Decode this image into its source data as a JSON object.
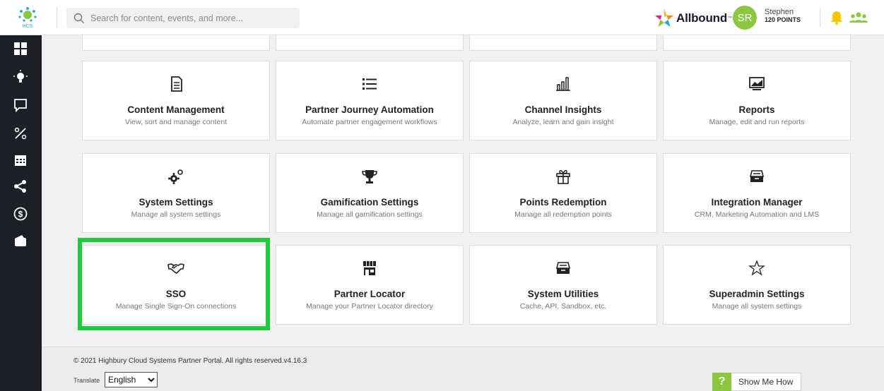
{
  "header": {
    "logo_text": "HCS",
    "search_placeholder": "Search for content, events, and more...",
    "brand_name": "Allbound",
    "brand_tm": "™",
    "avatar_initials": "SR",
    "user_name": "Stephen",
    "user_points": "120 POINTS"
  },
  "sidebar": {
    "items": [
      {
        "icon": "dashboard-grid-icon"
      },
      {
        "icon": "lightbulb-icon"
      },
      {
        "icon": "chat-icon"
      },
      {
        "icon": "percent-tools-icon"
      },
      {
        "icon": "calendar-icon"
      },
      {
        "icon": "share-icon"
      },
      {
        "icon": "dollar-icon"
      },
      {
        "icon": "wallet-icon"
      }
    ]
  },
  "cards": [
    {
      "title": "Content Management",
      "desc": "View, sort and manage content",
      "icon": "document-icon"
    },
    {
      "title": "Partner Journey Automation",
      "desc": "Automate partner engagement workflows",
      "icon": "list-icon"
    },
    {
      "title": "Channel Insights",
      "desc": "Analyze, learn and gain insight",
      "icon": "bar-chart-icon"
    },
    {
      "title": "Reports",
      "desc": "Manage, edit and run reports",
      "icon": "monitor-chart-icon"
    },
    {
      "title": "System Settings",
      "desc": "Manage all system settings",
      "icon": "gears-icon"
    },
    {
      "title": "Gamification Settings",
      "desc": "Manage all gamification settings",
      "icon": "trophy-icon"
    },
    {
      "title": "Points Redemption",
      "desc": "Manage all redemption points",
      "icon": "gift-icon"
    },
    {
      "title": "Integration Manager",
      "desc": "CRM, Marketing Automation and LMS",
      "icon": "archive-box-icon"
    },
    {
      "title": "SSO",
      "desc": "Manage Single Sign-On connections",
      "icon": "handshake-icon"
    },
    {
      "title": "Partner Locator",
      "desc": "Manage your Partner Locator directory",
      "icon": "storefront-icon"
    },
    {
      "title": "System Utilities",
      "desc": "Cache, API, Sandbox, etc.",
      "icon": "utility-box-icon"
    },
    {
      "title": "Superadmin Settings",
      "desc": "Manage all system settings",
      "icon": "star-icon"
    }
  ],
  "footer": {
    "copyright": "© 2021 Highbury Cloud Systems Partner Portal. All rights reserved.v4.16.3",
    "translate_label": "Translate",
    "language_selected": "English"
  },
  "help": {
    "q_mark": "?",
    "label": "Show Me How"
  },
  "colors": {
    "accent_green": "#8dc63f",
    "highlight_green": "#1fcc3c",
    "sidebar_bg": "#1c1f26"
  }
}
